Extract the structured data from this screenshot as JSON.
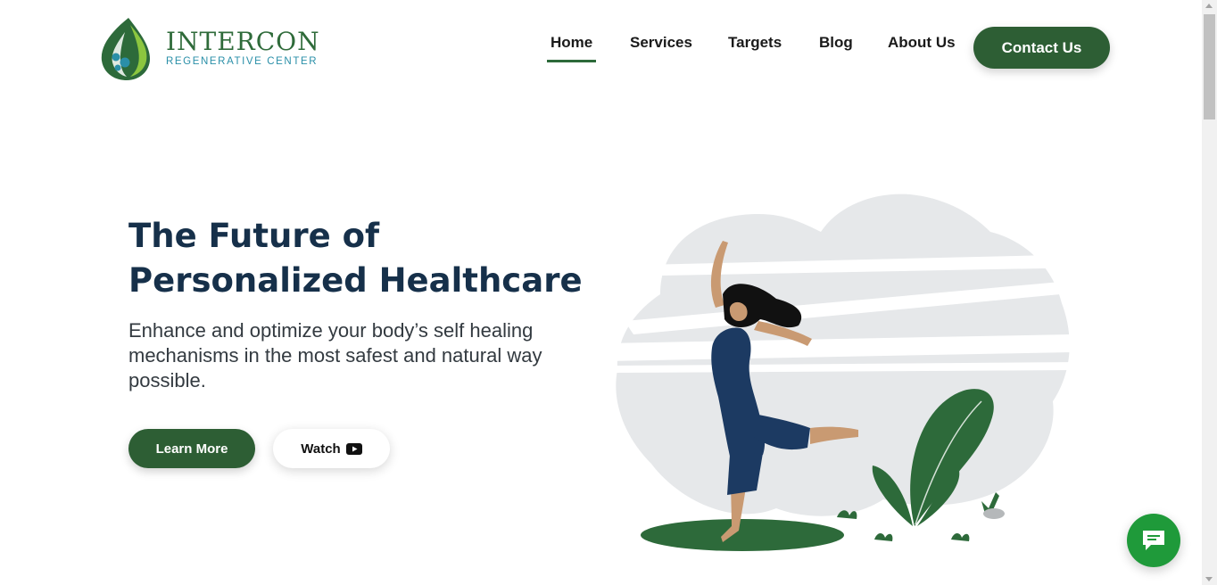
{
  "brand": {
    "name": "INTERCON",
    "tagline": "REGENERATIVE CENTER",
    "primary_color": "#2d5e34",
    "accent_color": "#2a8fa8"
  },
  "nav": {
    "items": [
      {
        "label": "Home",
        "active": true
      },
      {
        "label": "Services",
        "active": false
      },
      {
        "label": "Targets",
        "active": false
      },
      {
        "label": "Blog",
        "active": false
      },
      {
        "label": "About Us",
        "active": false
      }
    ],
    "contact_label": "Contact Us"
  },
  "hero": {
    "title": "The Future of Personalized Healthcare",
    "subtitle": "Enhance and optimize your body’s self healing mechanisms in the most safest and natural way possible.",
    "learn_more_label": "Learn More",
    "watch_label": "Watch",
    "watch_icon": "youtube-icon",
    "illustration": "woman-dancing-with-plants"
  },
  "chat": {
    "icon": "chat-bubble-icon",
    "color": "#1f9a3a"
  }
}
